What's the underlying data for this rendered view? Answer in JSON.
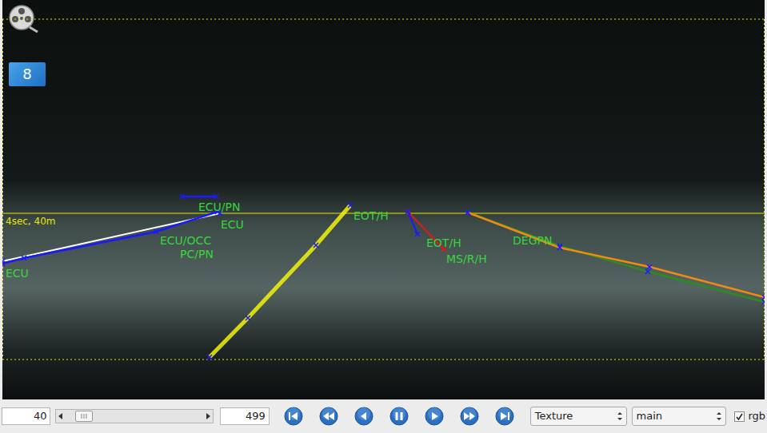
{
  "player": {
    "badge": "8"
  },
  "overlay": {
    "horizon_label": "4sec, 40m",
    "tracks": [
      {
        "color": "#ffffff"
      },
      {
        "color": "#1a1aff"
      },
      {
        "color": "#1a1aff"
      },
      {
        "color": "#f2f20a"
      },
      {
        "color": "#e01818"
      },
      {
        "color": "#1a1aff"
      },
      {
        "color": "#2e8b22"
      },
      {
        "color": "#f08a10"
      }
    ],
    "labels": [
      {
        "text": "ECU",
        "color": "#39d43c"
      },
      {
        "text": "ECU",
        "color": "#39d43c"
      },
      {
        "text": "ECU/OCC",
        "color": "#39d43c"
      },
      {
        "text": "PC/PN",
        "color": "#39d43c"
      },
      {
        "text": "ECU/PN",
        "color": "#39d43c"
      },
      {
        "text": "EOT/H",
        "color": "#39d43c"
      },
      {
        "text": "EOT/H",
        "color": "#39d43c"
      },
      {
        "text": "MS/R/H",
        "color": "#39d43c"
      },
      {
        "text": "DEGPN",
        "color": "#39d43c"
      }
    ]
  },
  "controls": {
    "frame": "40",
    "slider": {
      "level": 0.09
    },
    "total": "499",
    "view_select": {
      "value": "Texture"
    },
    "channel_select": {
      "value": "main"
    },
    "rgb": {
      "label": "rgb",
      "checked": true
    }
  }
}
